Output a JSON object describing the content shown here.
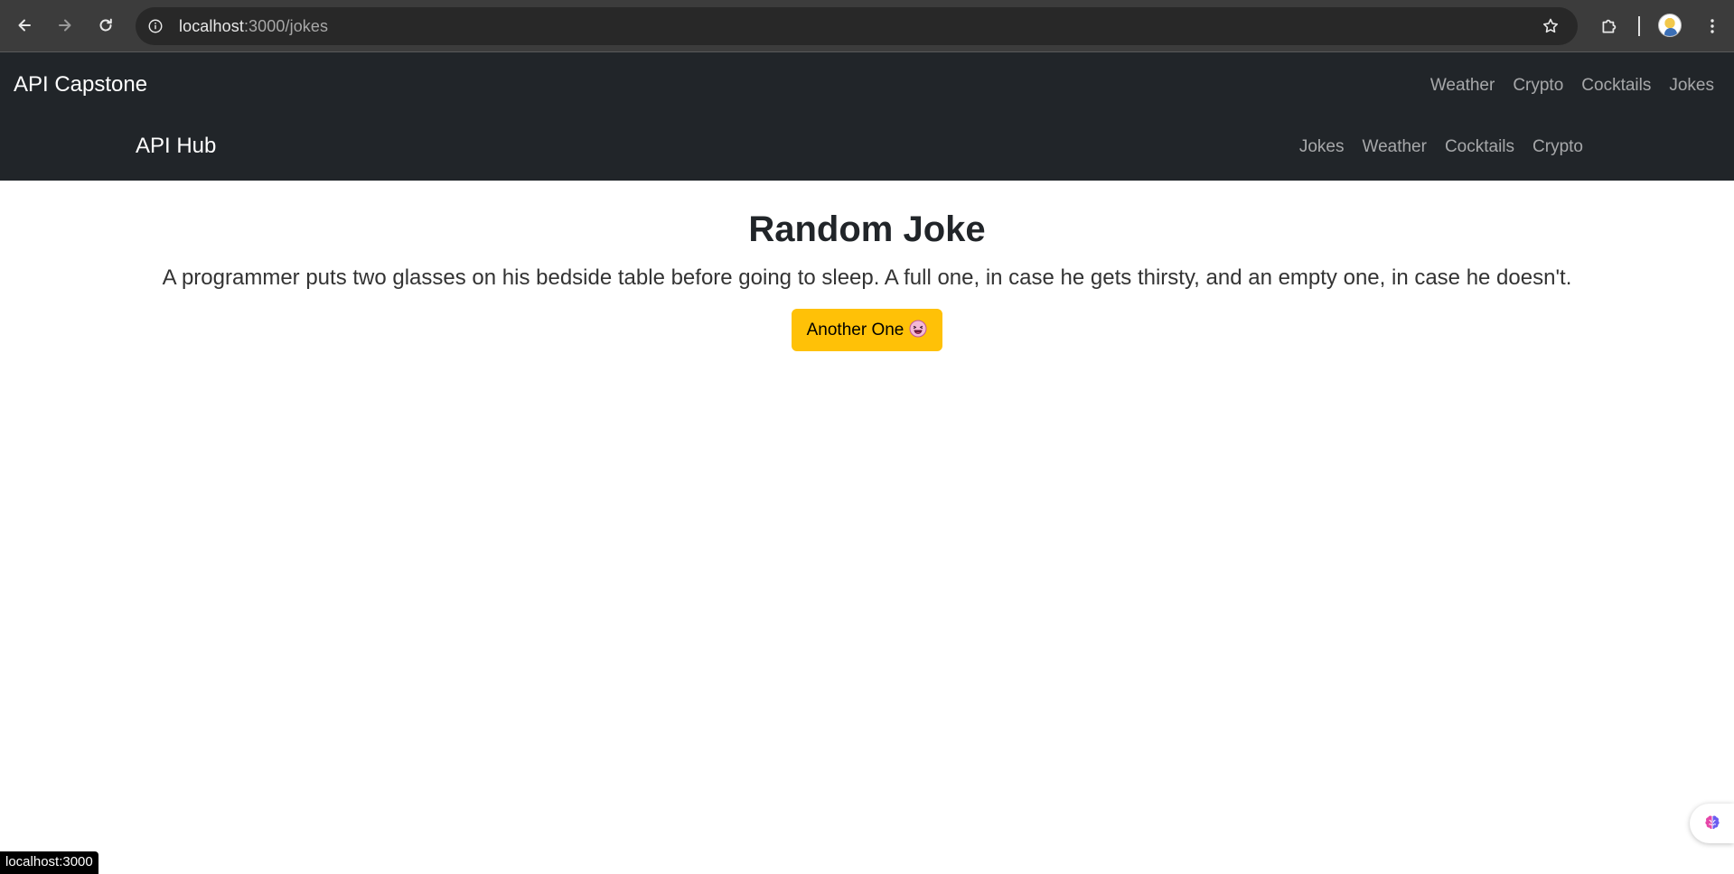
{
  "browser": {
    "url_host": "localhost",
    "url_path": ":3000/jokes"
  },
  "navbar_primary": {
    "brand": "API Capstone",
    "links": [
      "Weather",
      "Crypto",
      "Cocktails",
      "Jokes"
    ]
  },
  "navbar_secondary": {
    "brand": "API Hub",
    "links": [
      "Jokes",
      "Weather",
      "Cocktails",
      "Crypto"
    ]
  },
  "main": {
    "title": "Random Joke",
    "joke": "A programmer puts two glasses on his bedside table before going to sleep. A full one, in case he gets thirsty, and an empty one, in case he doesn't.",
    "button_label": "Another One"
  },
  "status_bar": {
    "text": "localhost:3000"
  },
  "colors": {
    "navbar_bg": "#212529",
    "button_bg": "#ffc107",
    "browser_bg": "#3c3c3c"
  },
  "icons": {
    "back": "back-arrow-icon",
    "forward": "forward-arrow-icon",
    "reload": "reload-icon",
    "site_info": "site-info-icon",
    "bookmark": "star-icon",
    "extensions": "puzzle-icon",
    "menu": "kebab-menu-icon",
    "button_emoji": "laughing-face-emoji",
    "widget": "brain-icon"
  }
}
